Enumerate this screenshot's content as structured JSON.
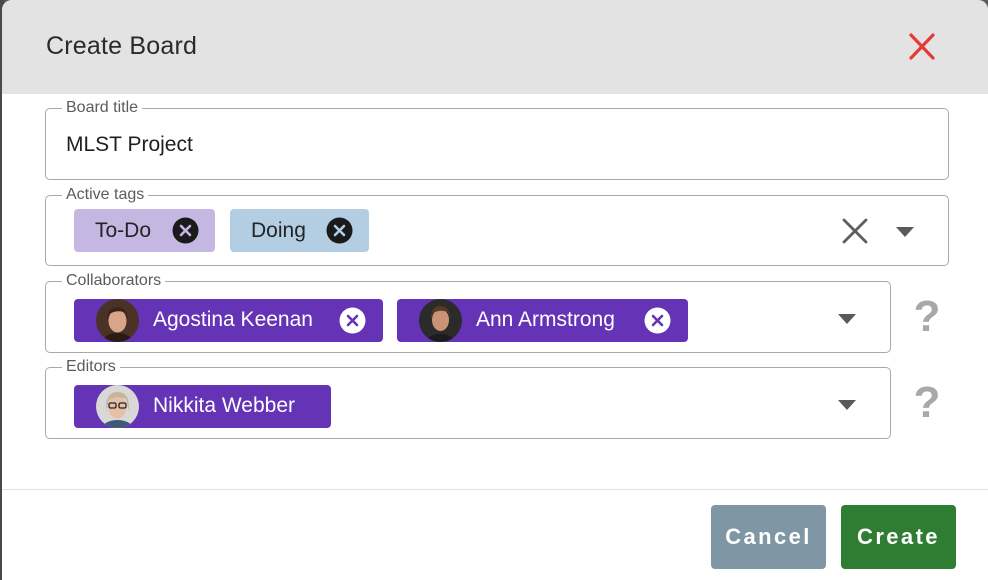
{
  "dialog": {
    "title": "Create Board",
    "close_icon": "close-x-icon"
  },
  "board_title_field": {
    "legend": "Board title",
    "value": "MLST Project"
  },
  "active_tags_field": {
    "legend": "Active tags",
    "tags": [
      {
        "label": "To-Do",
        "color": "#c4b7e2"
      },
      {
        "label": "Doing",
        "color": "#b3cde3"
      }
    ],
    "clear_icon": "clear-x-icon",
    "dropdown_icon": "chevron-down-icon"
  },
  "collaborators_field": {
    "legend": "Collaborators",
    "users": [
      {
        "name": "Agostina Keenan"
      },
      {
        "name": "Ann Armstrong"
      }
    ],
    "help_text": "?"
  },
  "editors_field": {
    "legend": "Editors",
    "users": [
      {
        "name": "Nikkita Webber"
      }
    ],
    "help_text": "?"
  },
  "footer": {
    "cancel_label": "Cancel",
    "create_label": "Create"
  },
  "colors": {
    "chip_purple": "#6533b6",
    "close_red": "#e53935",
    "create_green": "#2e7d32",
    "cancel_gray": "#7f96a4"
  }
}
